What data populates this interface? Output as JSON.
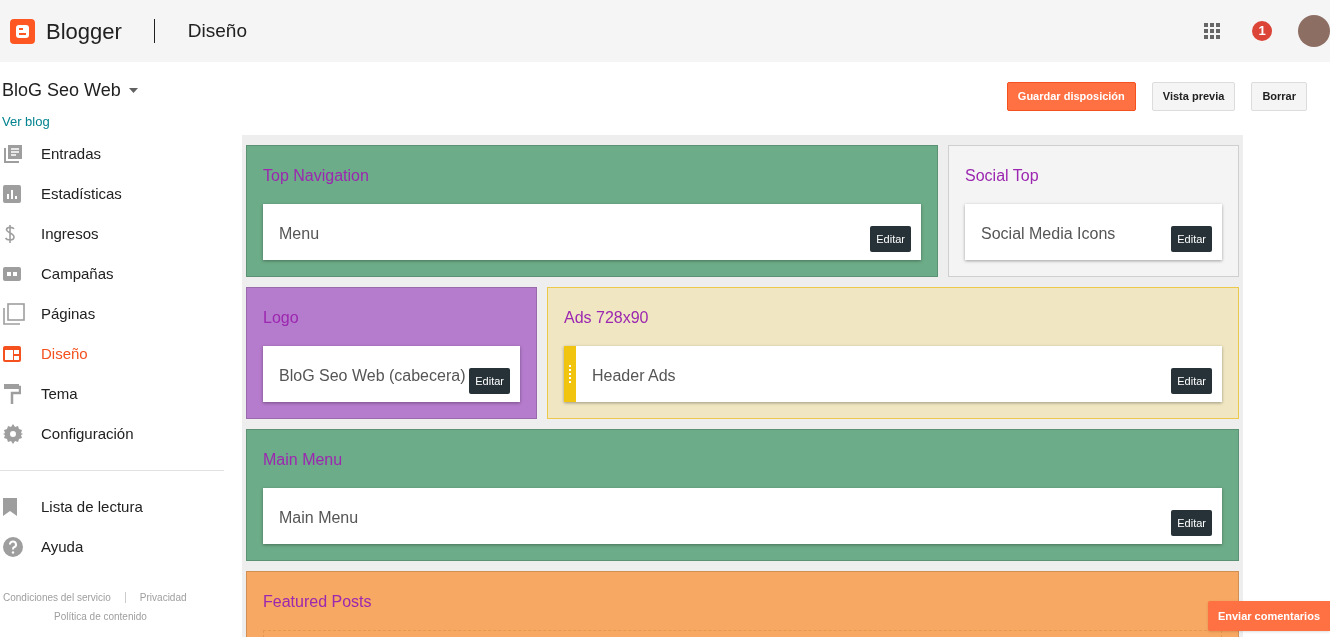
{
  "header": {
    "app_name": "Blogger",
    "page_title": "Diseño",
    "notification_count": "1"
  },
  "blog": {
    "name": "BloG Seo Web",
    "view_link": "Ver blog"
  },
  "actions": [
    {
      "label": "Guardar disposición",
      "kind": "primary"
    },
    {
      "label": "Vista previa",
      "kind": "secondary"
    },
    {
      "label": "Borrar",
      "kind": "secondary"
    }
  ],
  "sidebar": {
    "items": [
      {
        "label": "Entradas",
        "selected": false
      },
      {
        "label": "Estadísticas",
        "selected": false
      },
      {
        "label": "Ingresos",
        "selected": false
      },
      {
        "label": "Campañas",
        "selected": false
      },
      {
        "label": "Páginas",
        "selected": false
      },
      {
        "label": "Diseño",
        "selected": true
      },
      {
        "label": "Tema",
        "selected": false
      },
      {
        "label": "Configuración",
        "selected": false
      }
    ],
    "secondary_items": [
      {
        "label": "Lista de lectura"
      },
      {
        "label": "Ayuda"
      }
    ],
    "footer_links": [
      "Condiciones del servicio",
      "Privacidad",
      "Política de contenido"
    ]
  },
  "layout": {
    "rows": [
      {
        "sections": [
          {
            "title": "Top Navigation",
            "kind": "wide",
            "color": "#6dac88",
            "widgets": [
              {
                "name": "Menu",
                "button": "Editar",
                "dragging": false
              }
            ]
          },
          {
            "title": "Social Top",
            "kind": "narrow",
            "color": "#f4f4f4",
            "widgets": [
              {
                "name": "Social Media Icons",
                "button": "Editar",
                "dragging": false
              }
            ]
          }
        ]
      },
      {
        "sections": [
          {
            "title": "Logo",
            "kind": "narrow",
            "color": "#b57bcc",
            "widgets": [
              {
                "name": "BloG Seo Web (cabecera)",
                "button": "Editar",
                "dragging": false
              }
            ]
          },
          {
            "title": "Ads 728x90",
            "kind": "wide",
            "color": "#f0e6c2",
            "widgets": [
              {
                "name": "Header Ads",
                "button": "Editar",
                "dragging": true
              }
            ]
          }
        ]
      },
      {
        "sections": [
          {
            "title": "Main Menu",
            "kind": "wide",
            "color": "#6dac88",
            "widgets": [
              {
                "name": "Main Menu",
                "button": "Editar",
                "dragging": false
              }
            ]
          }
        ]
      },
      {
        "sections": [
          {
            "title": "Featured Posts",
            "kind": "wide",
            "color": "#f7a862"
          }
        ]
      }
    ]
  },
  "feedback_button": "Enviar comentarios"
}
